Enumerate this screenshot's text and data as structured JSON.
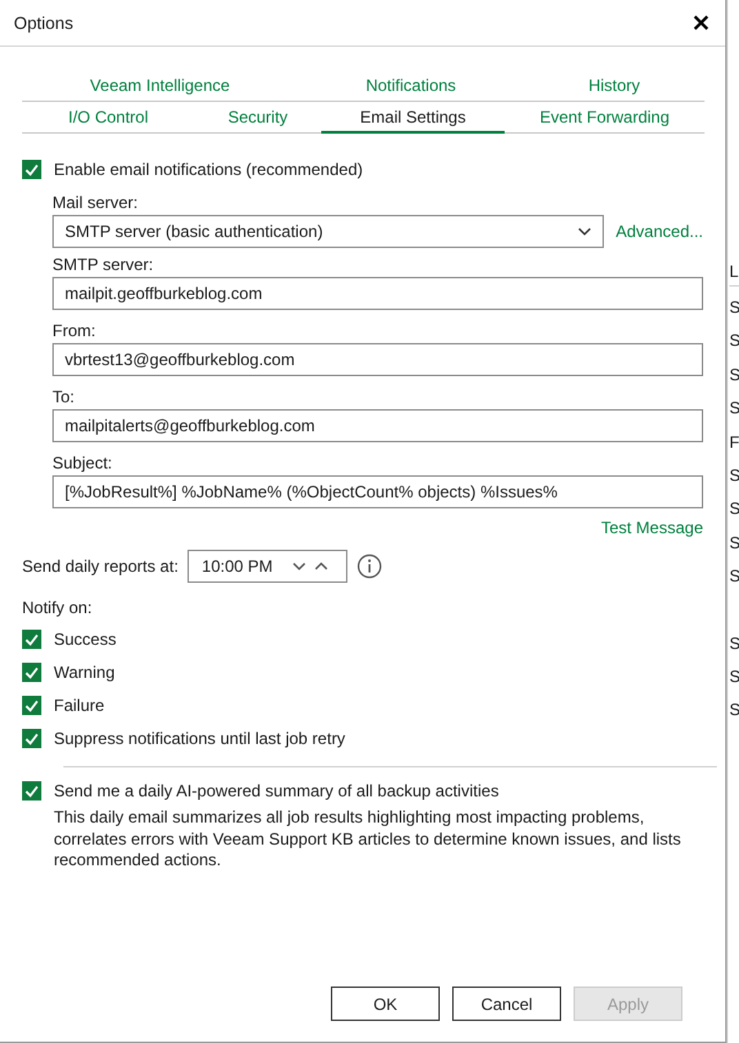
{
  "window": {
    "title": "Options"
  },
  "tab_rows": [
    [
      {
        "label": "Veeam Intelligence",
        "selected": false
      },
      {
        "label": "Notifications",
        "selected": false
      },
      {
        "label": "History",
        "selected": false
      }
    ],
    [
      {
        "label": "I/O Control",
        "selected": false
      },
      {
        "label": "Security",
        "selected": false
      },
      {
        "label": "Email Settings",
        "selected": true
      },
      {
        "label": "Event Forwarding",
        "selected": false
      }
    ]
  ],
  "enable_email": {
    "label": "Enable email notifications (recommended)",
    "checked": true
  },
  "mail_server": {
    "label": "Mail server:",
    "value": "SMTP server (basic authentication)",
    "advanced_link": "Advanced..."
  },
  "fields": [
    {
      "label": "SMTP server:",
      "value": "mailpit.geoffburkeblog.com"
    },
    {
      "label": "From:",
      "value": "vbrtest13@geoffburkeblog.com"
    },
    {
      "label": "To:",
      "value": "mailpitalerts@geoffburkeblog.com"
    },
    {
      "label": "Subject:",
      "value": "[%JobResult%] %JobName% (%ObjectCount% objects) %Issues%"
    }
  ],
  "test_message_link": "Test Message",
  "daily_reports": {
    "label": "Send daily reports at:",
    "value": "10:00 PM"
  },
  "notify_on": {
    "label": "Notify on:",
    "options": [
      {
        "label": "Success",
        "checked": true
      },
      {
        "label": "Warning",
        "checked": true
      },
      {
        "label": "Failure",
        "checked": true
      },
      {
        "label": "Suppress notifications until last job retry",
        "checked": true
      }
    ]
  },
  "ai_summary": {
    "label": "Send me a daily AI-powered summary of all backup activities",
    "checked": true,
    "description": "This daily email summarizes all job results highlighting most impacting problems, correlates errors with Veeam Support KB articles to determine known issues, and lists recommended actions."
  },
  "buttons": [
    {
      "label": "OK",
      "disabled": false
    },
    {
      "label": "Cancel",
      "disabled": false
    },
    {
      "label": "Apply",
      "disabled": true
    }
  ],
  "background_window": {
    "header": "L",
    "rows_upper": [
      "S",
      "S",
      "S",
      "S",
      "F",
      "S",
      "S",
      "S",
      "S"
    ],
    "rows_lower": [
      "S",
      "S",
      "S"
    ]
  }
}
